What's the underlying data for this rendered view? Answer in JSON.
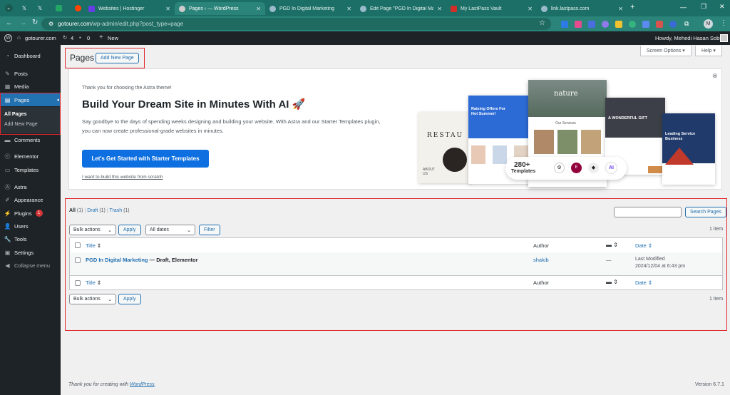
{
  "browser": {
    "tabs": [
      {
        "title": "Websites | Hostinger",
        "active": false
      },
      {
        "title": "Pages ‹ — WordPress",
        "active": true
      },
      {
        "title": "PGD In Digital Marketing",
        "active": false
      },
      {
        "title": "Edit Page \"PGD In Digital Mark…",
        "active": false
      },
      {
        "title": "My LastPass Vault",
        "active": false
      },
      {
        "title": "link.lastpass.com",
        "active": false
      }
    ],
    "new_tab": "+",
    "url_host": "gotourer.com",
    "url_path": "/wp-admin/edit.php?post_type=page",
    "profile_initial": "M"
  },
  "adminbar": {
    "site": "gotourer.com",
    "updates": "4",
    "comments": "0",
    "new": "New",
    "howdy": "Howdy, Mehedi Hasan Sobuj"
  },
  "sidebar": {
    "items": [
      {
        "label": "Dashboard",
        "icon": "dashboard-icon"
      },
      {
        "label": "Posts",
        "icon": "pin-icon"
      },
      {
        "label": "Media",
        "icon": "media-icon"
      },
      {
        "label": "Pages",
        "icon": "pages-icon"
      },
      {
        "label": "Comments",
        "icon": "comment-icon"
      },
      {
        "label": "Elementor",
        "icon": "elementor-icon"
      },
      {
        "label": "Templates",
        "icon": "folder-icon"
      },
      {
        "label": "Astra",
        "icon": "astra-icon"
      },
      {
        "label": "Appearance",
        "icon": "brush-icon"
      },
      {
        "label": "Plugins",
        "icon": "plug-icon"
      },
      {
        "label": "Users",
        "icon": "user-icon"
      },
      {
        "label": "Tools",
        "icon": "wrench-icon"
      },
      {
        "label": "Settings",
        "icon": "settings-icon"
      },
      {
        "label": "Collapse menu",
        "icon": "collapse-icon"
      }
    ],
    "plugins_badge": "1",
    "pages_sub": [
      "All Pages",
      "Add New Page"
    ]
  },
  "header": {
    "title": "Pages",
    "add_new": "Add New Page",
    "screen_options": "Screen Options ▾",
    "help": "Help ▾"
  },
  "banner": {
    "thanks": "Thank you for choosing the Astra theme!",
    "headline": "Build Your Dream Site in Minutes With AI 🚀",
    "body": "Say goodbye to the days of spending weeks designing and building your website. With Astra and our Starter Templates plugin, you can now create professional-grade websites in minutes.",
    "cta": "Let's Get Started with Starter Templates",
    "scratch": "I want to build this website from scratch",
    "mock": {
      "count": "280+",
      "templates": "Templates",
      "restaurant": "RESTAU",
      "about": "ABOUT US",
      "raising": "Raising Offers For Hot Summer!",
      "nature": "nature",
      "gift": "A WONDERFUL GIFT",
      "leading": "Leading Service Business",
      "ai": "AI",
      "services": "Our Services"
    }
  },
  "list": {
    "filters": [
      {
        "label": "All",
        "count": "(1)"
      },
      {
        "label": "Draft",
        "count": "(1)"
      },
      {
        "label": "Trash",
        "count": "(1)"
      }
    ],
    "search_button": "Search Pages",
    "search_placeholder": "",
    "bulk": "Bulk actions",
    "apply": "Apply",
    "dates": "All dates",
    "filter": "Filter",
    "count": "1 item",
    "columns": {
      "title": "Title",
      "author": "Author",
      "date": "Date"
    },
    "rows": [
      {
        "title": "PGD In Digital Marketing",
        "state": "— Draft, Elementor",
        "author": "shakib",
        "comments": "—",
        "date_label": "Last Modified",
        "date": "2024/12/04 at 6:43 pm"
      }
    ]
  },
  "footer": {
    "thanks": "Thank you for creating with ",
    "wp": "WordPress",
    "dot": ".",
    "version": "Version 6.7.1"
  }
}
